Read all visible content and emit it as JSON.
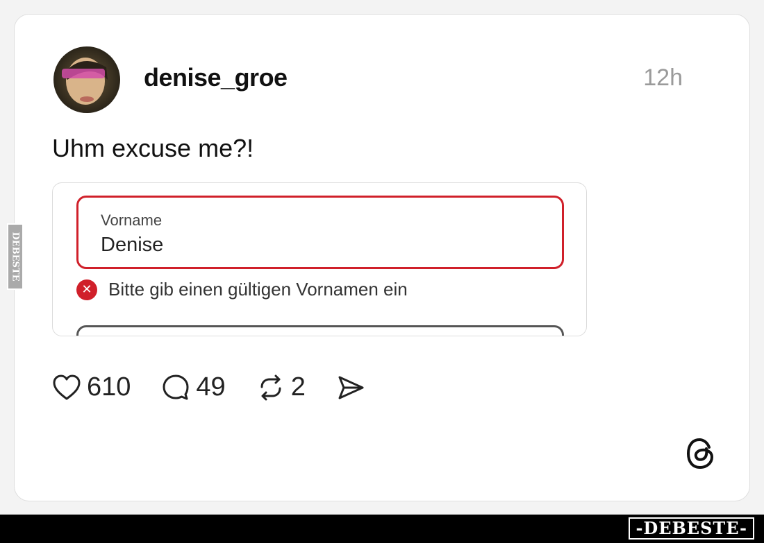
{
  "post": {
    "username": "denise_groe",
    "timestamp": "12h",
    "text": "Uhm excuse me?!"
  },
  "embed": {
    "field_label": "Vorname",
    "field_value": "Denise",
    "error_message": "Bitte gib einen gültigen Vornamen ein"
  },
  "actions": {
    "likes": "610",
    "replies": "49",
    "reposts": "2"
  },
  "icons": [
    "heart-icon",
    "comment-icon",
    "repost-icon",
    "share-icon",
    "threads-logo-icon",
    "error-icon"
  ],
  "watermark": {
    "bottom": "-DEBESTE-",
    "side": "DEBESTE"
  },
  "colors": {
    "error": "#d0202a",
    "text": "#111111",
    "muted": "#9a9a9a"
  }
}
